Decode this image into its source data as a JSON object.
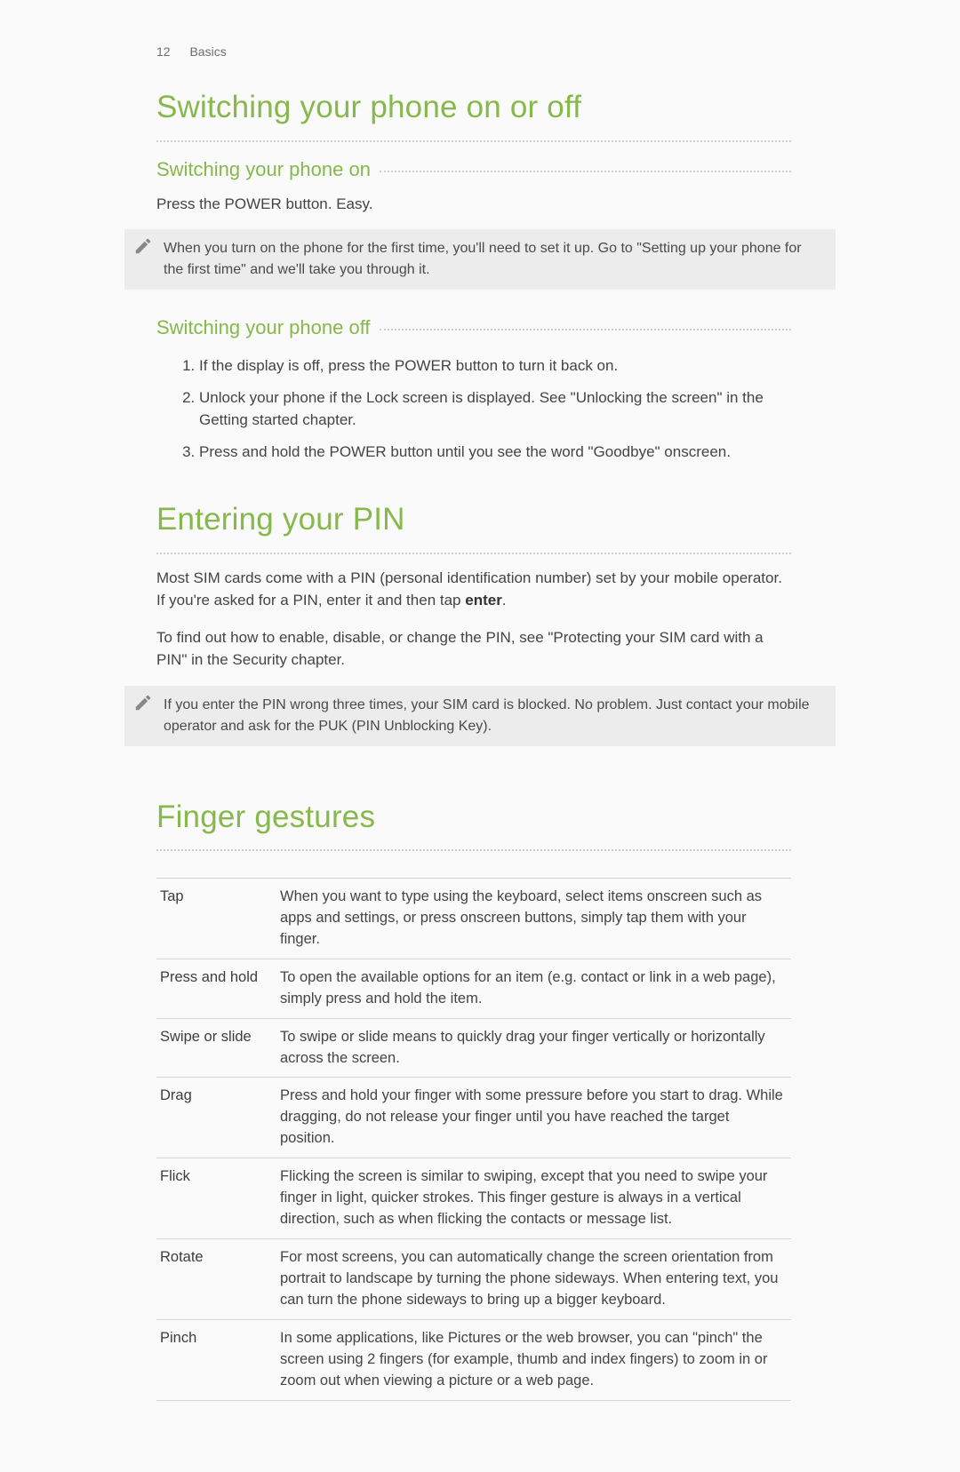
{
  "header": {
    "page_number": "12",
    "chapter": "Basics"
  },
  "section1": {
    "title": "Switching your phone on or off",
    "sub_on": {
      "title": "Switching your phone on",
      "body": "Press the POWER button. Easy.",
      "note": "When you turn on the phone for the first time, you'll need to set it up. Go to \"Setting up your phone for the first time\" and we'll take you through it."
    },
    "sub_off": {
      "title": "Switching your phone off",
      "steps": [
        "If the display is off, press the POWER button to turn it back on.",
        "Unlock your phone if the Lock screen is displayed. See \"Unlocking the screen\" in the Getting started chapter.",
        "Press and hold the POWER button until you see the word \"Goodbye\" onscreen."
      ]
    }
  },
  "section2": {
    "title": "Entering your PIN",
    "p1_a": "Most SIM cards come with a PIN (personal identification number) set by your mobile operator. If you're asked for a PIN, enter it and then tap ",
    "p1_bold": "enter",
    "p1_b": ".",
    "p2": "To find out how to enable, disable, or change the PIN, see \"Protecting your SIM card with a PIN\" in the Security chapter.",
    "note": "If you enter the PIN wrong three times, your SIM card is blocked. No problem. Just contact your mobile operator and ask for the PUK (PIN Unblocking Key)."
  },
  "section3": {
    "title": "Finger gestures",
    "rows": [
      {
        "term": "Tap",
        "desc": "When you want to type using the keyboard, select items onscreen such as apps and settings, or press onscreen buttons, simply tap them with your finger."
      },
      {
        "term": "Press and hold",
        "desc": "To open the available options for an item (e.g. contact or link in a web page), simply press and hold the item."
      },
      {
        "term": "Swipe or slide",
        "desc": "To swipe or slide means to quickly drag your finger vertically or horizontally across the screen."
      },
      {
        "term": "Drag",
        "desc": "Press and hold your finger with some pressure before you start to drag. While dragging, do not release your finger until you have reached the target position."
      },
      {
        "term": "Flick",
        "desc": "Flicking the screen is similar to swiping, except that you need to swipe your finger in light, quicker strokes. This finger gesture is always in a vertical direction, such as when flicking the contacts or message list."
      },
      {
        "term": "Rotate",
        "desc": "For most screens, you can automatically change the screen orientation from portrait to landscape by turning the phone sideways. When entering text, you can turn the phone sideways to bring up a bigger keyboard."
      },
      {
        "term": "Pinch",
        "desc": "In some applications, like Pictures or the web browser, you can \"pinch\" the screen using 2 fingers (for example, thumb and index fingers) to zoom in or zoom out when viewing a picture or a web page."
      }
    ]
  }
}
